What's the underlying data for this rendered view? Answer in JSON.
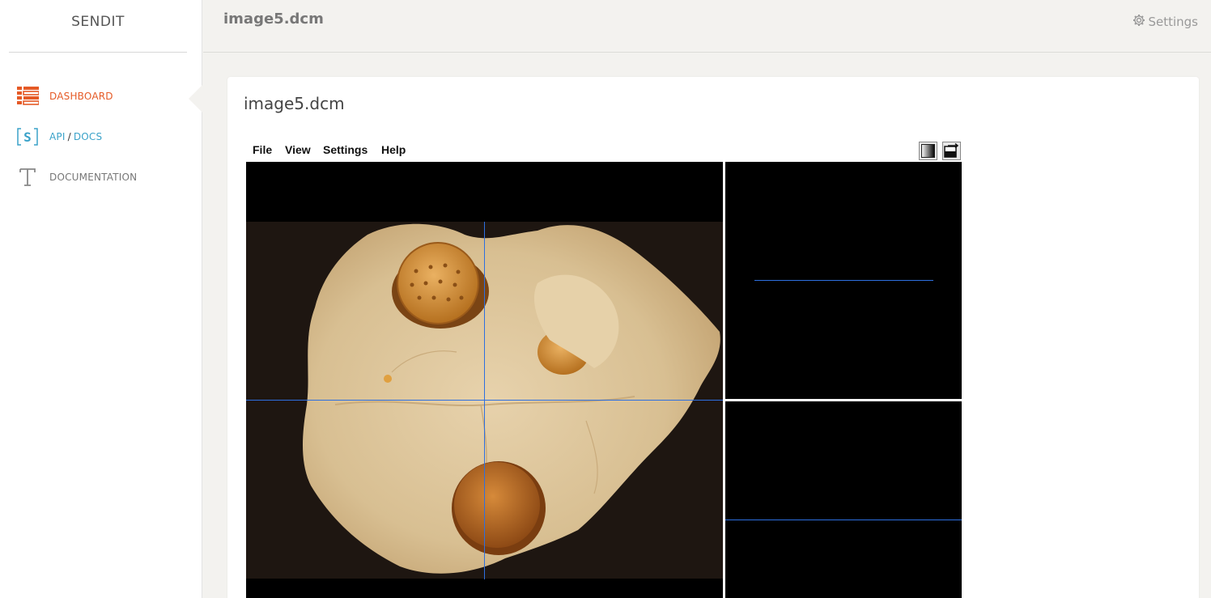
{
  "sidebar": {
    "brand": "SENDIT",
    "items": [
      {
        "label": "DASHBOARD",
        "icon": "list-icon"
      },
      {
        "label_api": "API",
        "label_sep": "/",
        "label_docs": "DOCS",
        "icon": "bracket-s-icon"
      },
      {
        "label": "DOCUMENTATION",
        "icon": "text-t-icon"
      }
    ]
  },
  "header": {
    "title": "image5.dcm",
    "settings_label": "Settings"
  },
  "card": {
    "title": "image5.dcm"
  },
  "viewer": {
    "menu": [
      "File",
      "View",
      "Settings",
      "Help"
    ],
    "tools": [
      "window-level-icon",
      "swap-layout-icon"
    ]
  },
  "colors": {
    "accent": "#e55a26",
    "link": "#3aa2c9",
    "crosshair": "#2d6fe0"
  }
}
